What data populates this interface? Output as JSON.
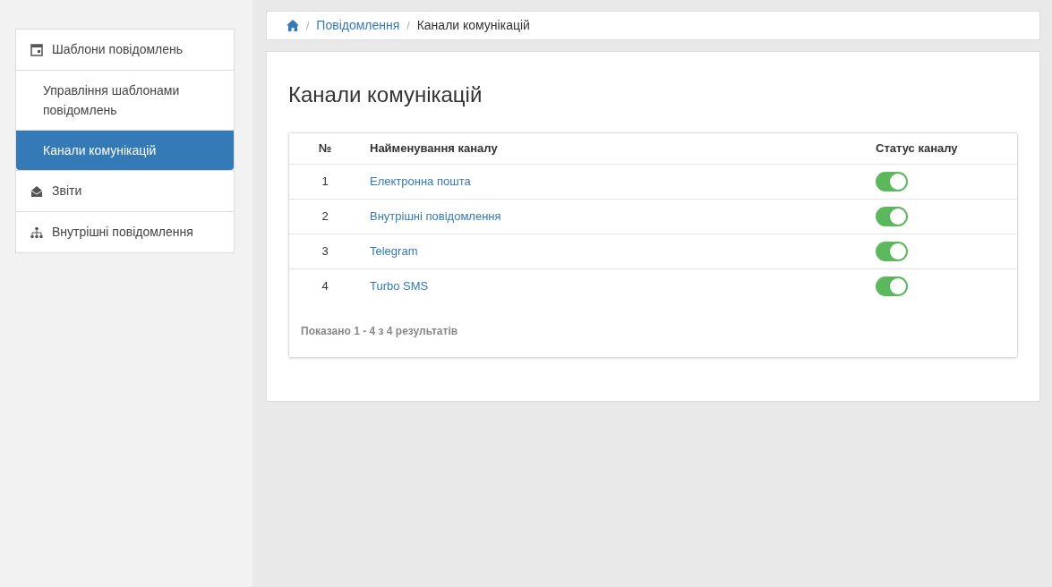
{
  "sidebar": {
    "items": [
      {
        "kind": "section",
        "label": "Шаблони повідомлень",
        "selected": false
      },
      {
        "kind": "subitem",
        "label": "Управління шаблонами повідомлень",
        "selected": false
      },
      {
        "kind": "subitem",
        "label": "Канали комунікацій",
        "selected": true
      },
      {
        "kind": "section",
        "label": "Звіти",
        "selected": false
      },
      {
        "kind": "section",
        "label": "Внутрішні повідомлення",
        "selected": false
      }
    ]
  },
  "breadcrumb": {
    "separator": "/",
    "items": [
      "Повідомлення",
      "Канали комунікацій"
    ]
  },
  "page": {
    "title": "Канали комунікацій"
  },
  "table": {
    "columns": [
      "№",
      "Найменування каналу",
      "Статус каналу"
    ],
    "rows": [
      {
        "number": "1",
        "name": "Електронна пошта",
        "on": true
      },
      {
        "number": "2",
        "name": "Внутрішні повідомлення",
        "on": true
      },
      {
        "number": "3",
        "name": "Telegram",
        "on": true
      },
      {
        "number": "4",
        "name": "Turbo SMS",
        "on": true
      }
    ],
    "summary": "Показано 1 - 4 з 4 результатів"
  }
}
